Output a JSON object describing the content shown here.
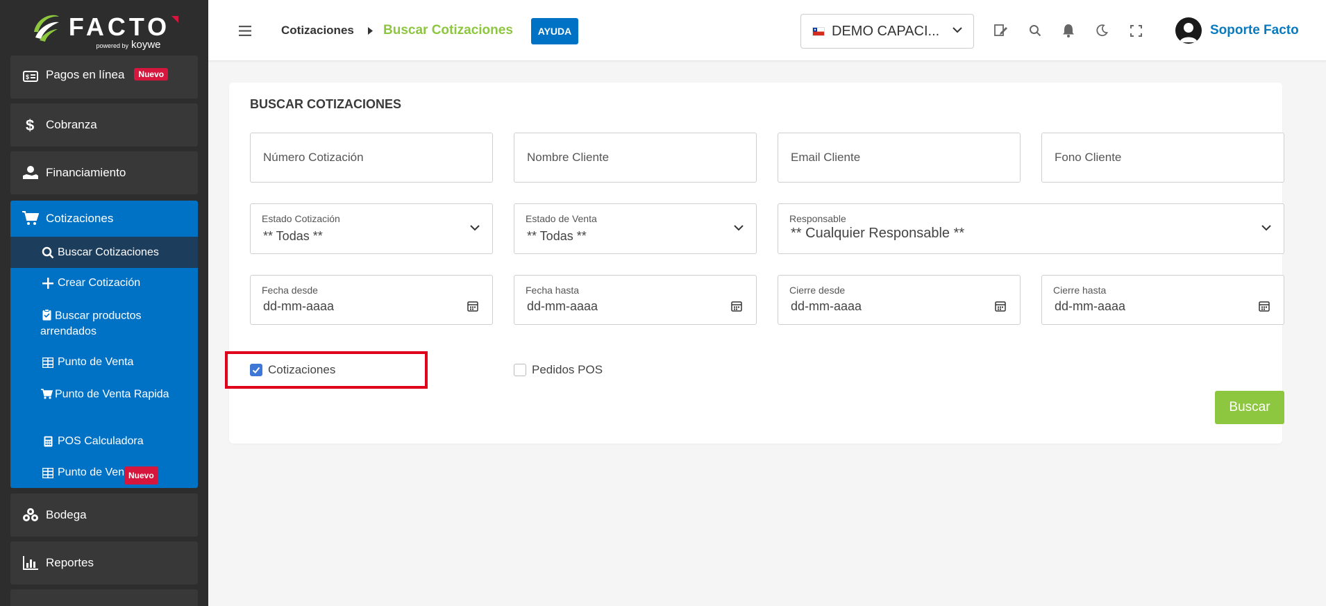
{
  "brand": {
    "name": "FACTO",
    "powered": "powered by",
    "partner": "koywe"
  },
  "sidebar": {
    "top_items": [
      {
        "label": "Pagos en línea",
        "badge": "Nuevo",
        "icon": "money-bill-icon"
      },
      {
        "label": "Cobranza",
        "icon": "dollar-icon"
      },
      {
        "label": "Financiamiento",
        "icon": "hand-money-icon"
      }
    ],
    "cotizaciones": {
      "label": "Cotizaciones",
      "children": [
        {
          "label": "Buscar Cotizaciones",
          "icon": "search-icon"
        },
        {
          "label": "Crear Cotización",
          "icon": "plus-icon"
        },
        {
          "label": "Buscar productos arrendados",
          "icon": "clipboard-icon"
        },
        {
          "label": "Punto de Venta",
          "icon": "table-icon"
        },
        {
          "label": "Punto de Venta Rapida",
          "icon": "cart-icon"
        },
        {
          "label": "POS Calculadora",
          "icon": "calculator-icon"
        },
        {
          "label": "Punto de Venta",
          "badge": "Nuevo",
          "icon": "table-icon"
        }
      ]
    },
    "bottom_items": [
      {
        "label": "Bodega",
        "icon": "boxes-icon"
      },
      {
        "label": "Reportes",
        "icon": "chart-icon"
      }
    ]
  },
  "header": {
    "breadcrumb_parent": "Cotizaciones",
    "breadcrumb_current": "Buscar Cotizaciones",
    "help_label": "AYUDA",
    "company": "DEMO CAPACI...",
    "user": "Soporte Facto"
  },
  "form": {
    "title": "BUSCAR COTIZACIONES",
    "numero_placeholder": "Número Cotización",
    "nombre_placeholder": "Nombre Cliente",
    "email_placeholder": "Email Cliente",
    "fono_placeholder": "Fono Cliente",
    "estado_cot_label": "Estado Cotización",
    "estado_cot_value": "** Todas **",
    "estado_venta_label": "Estado de Venta",
    "estado_venta_value": "** Todas **",
    "responsable_label": "Responsable",
    "responsable_value": "** Cualquier Responsable **",
    "fecha_desde_label": "Fecha desde",
    "fecha_hasta_label": "Fecha hasta",
    "cierre_desde_label": "Cierre desde",
    "cierre_hasta_label": "Cierre hasta",
    "date_placeholder": "dd-mm-aaaa",
    "chk_cotizaciones": "Cotizaciones",
    "chk_cotizaciones_checked": true,
    "chk_pedidos": "Pedidos POS",
    "chk_pedidos_checked": false,
    "search_button": "Buscar"
  },
  "colors": {
    "sidebar_bg": "#2d2d2d",
    "accent_blue": "#0072c6",
    "accent_green": "#8dc63f",
    "badge_red": "#d6163c",
    "highlight_red": "#e0001b"
  }
}
